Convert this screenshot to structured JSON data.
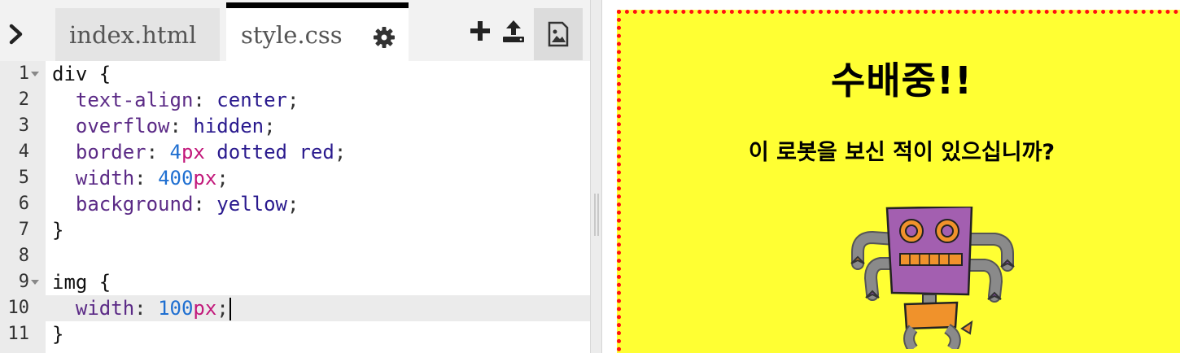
{
  "editor": {
    "tabs": [
      {
        "label": "index.html",
        "active": false
      },
      {
        "label": "style.css",
        "active": true
      }
    ],
    "toolbar": {
      "toggle_icon": "chevron-right-icon",
      "settings_icon": "gear-icon",
      "add_icon": "plus-icon",
      "upload_icon": "upload-icon",
      "image_icon": "image-icon"
    },
    "current_line": 10,
    "lines": [
      {
        "num": "1",
        "fold": true,
        "tokens": [
          {
            "t": "div {",
            "c": "c-sel"
          }
        ]
      },
      {
        "num": "2",
        "fold": false,
        "tokens": [
          {
            "t": "  text-align",
            "c": "c-prop"
          },
          {
            "t": ": ",
            "c": "c-punct"
          },
          {
            "t": "center",
            "c": "c-val"
          },
          {
            "t": ";",
            "c": "c-punct"
          }
        ]
      },
      {
        "num": "3",
        "fold": false,
        "tokens": [
          {
            "t": "  overflow",
            "c": "c-prop"
          },
          {
            "t": ": ",
            "c": "c-punct"
          },
          {
            "t": "hidden",
            "c": "c-val"
          },
          {
            "t": ";",
            "c": "c-punct"
          }
        ]
      },
      {
        "num": "4",
        "fold": false,
        "tokens": [
          {
            "t": "  border",
            "c": "c-prop"
          },
          {
            "t": ": ",
            "c": "c-punct"
          },
          {
            "t": "4",
            "c": "c-num"
          },
          {
            "t": "px",
            "c": "c-unit"
          },
          {
            "t": " dotted red",
            "c": "c-val"
          },
          {
            "t": ";",
            "c": "c-punct"
          }
        ]
      },
      {
        "num": "5",
        "fold": false,
        "tokens": [
          {
            "t": "  width",
            "c": "c-prop"
          },
          {
            "t": ": ",
            "c": "c-punct"
          },
          {
            "t": "400",
            "c": "c-num"
          },
          {
            "t": "px",
            "c": "c-unit"
          },
          {
            "t": ";",
            "c": "c-punct"
          }
        ]
      },
      {
        "num": "6",
        "fold": false,
        "tokens": [
          {
            "t": "  background",
            "c": "c-prop"
          },
          {
            "t": ": ",
            "c": "c-punct"
          },
          {
            "t": "yellow",
            "c": "c-val"
          },
          {
            "t": ";",
            "c": "c-punct"
          }
        ]
      },
      {
        "num": "7",
        "fold": false,
        "tokens": [
          {
            "t": "}",
            "c": "c-sel"
          }
        ]
      },
      {
        "num": "8",
        "fold": false,
        "tokens": []
      },
      {
        "num": "9",
        "fold": true,
        "tokens": [
          {
            "t": "img {",
            "c": "c-sel"
          }
        ]
      },
      {
        "num": "10",
        "fold": false,
        "caret": true,
        "tokens": [
          {
            "t": "  width",
            "c": "c-prop"
          },
          {
            "t": ": ",
            "c": "c-punct"
          },
          {
            "t": "100",
            "c": "c-num"
          },
          {
            "t": "px",
            "c": "c-unit"
          },
          {
            "t": ";",
            "c": "c-punct"
          }
        ]
      },
      {
        "num": "11",
        "fold": false,
        "tokens": [
          {
            "t": "}",
            "c": "c-sel"
          }
        ]
      }
    ]
  },
  "preview": {
    "heading": "수배중!!",
    "subheading": "이 로봇을 보신 적이 있으십니까?",
    "image_icon": "robot-image",
    "colors": {
      "background": "#ffff33",
      "border": "#ff1111"
    }
  }
}
